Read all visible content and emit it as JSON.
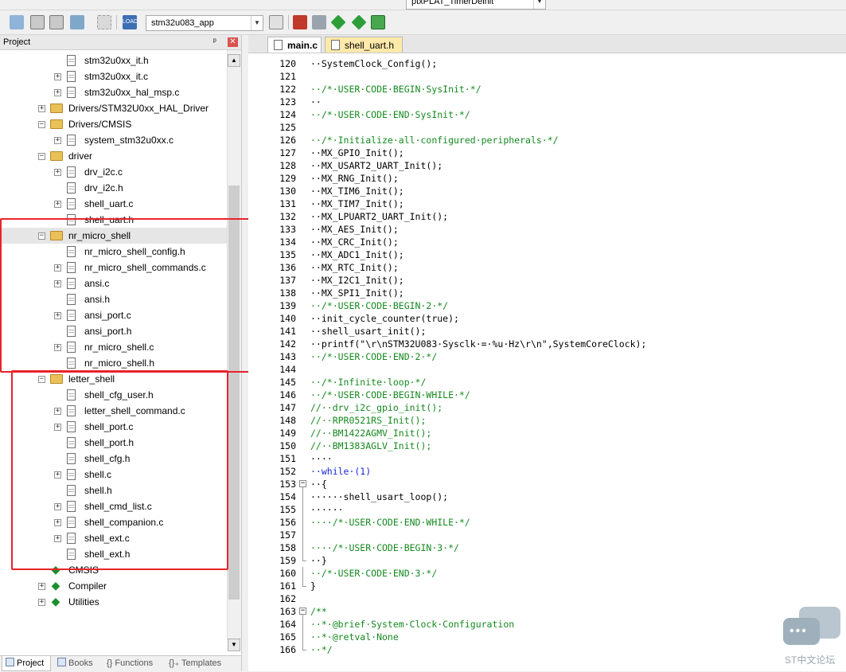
{
  "toolbar": {
    "function_combo": "ptxPLAT_TimerDeinit",
    "target_combo": "stm32u083_app"
  },
  "project_panel": {
    "title": "Project",
    "pin_glyph": "ᵖ",
    "close_glyph": "✕",
    "tree": [
      {
        "label": "stm32u0xx_it.h",
        "icon": "file",
        "expander": "none"
      },
      {
        "label": "stm32u0xx_it.c",
        "icon": "file",
        "expander": "plus"
      },
      {
        "label": "stm32u0xx_hal_msp.c",
        "icon": "file",
        "expander": "plus"
      },
      {
        "label": "Drivers/STM32U0xx_HAL_Driver",
        "icon": "folder",
        "expander": "plus"
      },
      {
        "label": "Drivers/CMSIS",
        "icon": "folder",
        "expander": "minus"
      },
      {
        "label": "system_stm32u0xx.c",
        "icon": "file",
        "expander": "plus"
      },
      {
        "label": "driver",
        "icon": "folder",
        "expander": "minus"
      },
      {
        "label": "drv_i2c.c",
        "icon": "file",
        "expander": "plus"
      },
      {
        "label": "drv_i2c.h",
        "icon": "file",
        "expander": "none"
      },
      {
        "label": "shell_uart.c",
        "icon": "file",
        "expander": "plus"
      },
      {
        "label": "shell_uart.h",
        "icon": "file",
        "expander": "none"
      },
      {
        "label": "nr_micro_shell",
        "icon": "folder",
        "expander": "minus",
        "selected": true
      },
      {
        "label": "nr_micro_shell_config.h",
        "icon": "file",
        "expander": "none"
      },
      {
        "label": "nr_micro_shell_commands.c",
        "icon": "file",
        "expander": "plus"
      },
      {
        "label": "ansi.c",
        "icon": "file",
        "expander": "plus"
      },
      {
        "label": "ansi.h",
        "icon": "file",
        "expander": "none"
      },
      {
        "label": "ansi_port.c",
        "icon": "file",
        "expander": "plus"
      },
      {
        "label": "ansi_port.h",
        "icon": "file",
        "expander": "none"
      },
      {
        "label": "nr_micro_shell.c",
        "icon": "file",
        "expander": "plus"
      },
      {
        "label": "nr_micro_shell.h",
        "icon": "file",
        "expander": "none"
      },
      {
        "label": "letter_shell",
        "icon": "folder",
        "expander": "minus"
      },
      {
        "label": "shell_cfg_user.h",
        "icon": "file",
        "expander": "none"
      },
      {
        "label": "letter_shell_command.c",
        "icon": "file",
        "expander": "plus"
      },
      {
        "label": "shell_port.c",
        "icon": "file",
        "expander": "plus"
      },
      {
        "label": "shell_port.h",
        "icon": "file",
        "expander": "none"
      },
      {
        "label": "shell_cfg.h",
        "icon": "file",
        "expander": "none"
      },
      {
        "label": "shell.c",
        "icon": "file",
        "expander": "plus"
      },
      {
        "label": "shell.h",
        "icon": "file",
        "expander": "none"
      },
      {
        "label": "shell_cmd_list.c",
        "icon": "file",
        "expander": "plus"
      },
      {
        "label": "shell_companion.c",
        "icon": "file",
        "expander": "plus"
      },
      {
        "label": "shell_ext.c",
        "icon": "file",
        "expander": "plus"
      },
      {
        "label": "shell_ext.h",
        "icon": "file",
        "expander": "none"
      },
      {
        "label": "CMSIS",
        "icon": "gem",
        "expander": "none"
      },
      {
        "label": "Compiler",
        "icon": "gem",
        "expander": "plus"
      },
      {
        "label": "Utilities",
        "icon": "gem",
        "expander": "plus"
      }
    ],
    "bottom_tabs": [
      {
        "label": "Project",
        "active": true
      },
      {
        "label": "Books",
        "active": false
      },
      {
        "label": "{} Functions",
        "active": false
      },
      {
        "label": "{}₊ Templates",
        "active": false
      }
    ]
  },
  "editor": {
    "tabs": [
      {
        "label": "main.c",
        "active": true
      },
      {
        "label": "shell_uart.h",
        "active": false
      }
    ],
    "lines": [
      {
        "n": "120",
        "t": "··SystemClock_Config();",
        "c": "code"
      },
      {
        "n": "121",
        "t": "",
        "c": "code"
      },
      {
        "n": "122",
        "t": "··/*·USER·CODE·BEGIN·SysInit·*/",
        "c": "comment"
      },
      {
        "n": "123",
        "t": "··",
        "c": "code"
      },
      {
        "n": "124",
        "t": "··/*·USER·CODE·END·SysInit·*/",
        "c": "comment"
      },
      {
        "n": "125",
        "t": "",
        "c": "code"
      },
      {
        "n": "126",
        "t": "··/*·Initialize·all·configured·peripherals·*/",
        "c": "comment"
      },
      {
        "n": "127",
        "t": "··MX_GPIO_Init();",
        "c": "code"
      },
      {
        "n": "128",
        "t": "··MX_USART2_UART_Init();",
        "c": "code"
      },
      {
        "n": "129",
        "t": "··MX_RNG_Init();",
        "c": "code"
      },
      {
        "n": "130",
        "t": "··MX_TIM6_Init();",
        "c": "code"
      },
      {
        "n": "131",
        "t": "··MX_TIM7_Init();",
        "c": "code"
      },
      {
        "n": "132",
        "t": "··MX_LPUART2_UART_Init();",
        "c": "code"
      },
      {
        "n": "133",
        "t": "··MX_AES_Init();",
        "c": "code"
      },
      {
        "n": "134",
        "t": "··MX_CRC_Init();",
        "c": "code"
      },
      {
        "n": "135",
        "t": "··MX_ADC1_Init();",
        "c": "code"
      },
      {
        "n": "136",
        "t": "··MX_RTC_Init();",
        "c": "code"
      },
      {
        "n": "137",
        "t": "··MX_I2C1_Init();",
        "c": "code"
      },
      {
        "n": "138",
        "t": "··MX_SPI1_Init();",
        "c": "code"
      },
      {
        "n": "139",
        "t": "··/*·USER·CODE·BEGIN·2·*/",
        "c": "comment"
      },
      {
        "n": "140",
        "t": "··init_cycle_counter(true);",
        "c": "code"
      },
      {
        "n": "141",
        "t": "··shell_usart_init();",
        "c": "code"
      },
      {
        "n": "142",
        "t": "··printf(\"\\r\\nSTM32U083·Sysclk·=·%u·Hz\\r\\n\",SystemCoreClock);",
        "c": "code"
      },
      {
        "n": "143",
        "t": "··/*·USER·CODE·END·2·*/",
        "c": "comment"
      },
      {
        "n": "144",
        "t": "",
        "c": "code"
      },
      {
        "n": "145",
        "t": "··/*·Infinite·loop·*/",
        "c": "comment"
      },
      {
        "n": "146",
        "t": "··/*·USER·CODE·BEGIN·WHILE·*/",
        "c": "comment"
      },
      {
        "n": "147",
        "t": "//··drv_i2c_gpio_init();",
        "c": "comment"
      },
      {
        "n": "148",
        "t": "//··RPR0521RS_Init();",
        "c": "comment"
      },
      {
        "n": "149",
        "t": "//··BM1422AGMV_Init();",
        "c": "comment"
      },
      {
        "n": "150",
        "t": "//··BM1383AGLV_Init();",
        "c": "comment"
      },
      {
        "n": "151",
        "t": "····",
        "c": "code"
      },
      {
        "n": "152",
        "t": "··while·(1)",
        "c": "keyword"
      },
      {
        "n": "153",
        "t": "··{",
        "c": "code",
        "fold": "box"
      },
      {
        "n": "154",
        "t": "······shell_usart_loop();",
        "c": "code",
        "fold": "line"
      },
      {
        "n": "155",
        "t": "······",
        "c": "code",
        "fold": "line"
      },
      {
        "n": "156",
        "t": "····/*·USER·CODE·END·WHILE·*/",
        "c": "comment",
        "fold": "line"
      },
      {
        "n": "157",
        "t": "",
        "c": "code",
        "fold": "line"
      },
      {
        "n": "158",
        "t": "····/*·USER·CODE·BEGIN·3·*/",
        "c": "comment",
        "fold": "line"
      },
      {
        "n": "159",
        "t": "··}",
        "c": "code",
        "fold": "end"
      },
      {
        "n": "160",
        "t": "··/*·USER·CODE·END·3·*/",
        "c": "comment",
        "fold": "line"
      },
      {
        "n": "161",
        "t": "}",
        "c": "code",
        "fold": "end"
      },
      {
        "n": "162",
        "t": "",
        "c": "code"
      },
      {
        "n": "163",
        "t": "/**",
        "c": "comment",
        "fold": "box"
      },
      {
        "n": "164",
        "t": "··*·@brief·System·Clock·Configuration",
        "c": "comment",
        "fold": "line"
      },
      {
        "n": "165",
        "t": "··*·@retval·None",
        "c": "comment",
        "fold": "line"
      },
      {
        "n": "166",
        "t": "··*/",
        "c": "comment",
        "fold": "end"
      }
    ]
  },
  "watermark": {
    "text": "ST中文论坛"
  },
  "colors": {
    "annotation_box": "#e8232a",
    "comment": "#15891f",
    "keyword": "#1a28d6"
  }
}
